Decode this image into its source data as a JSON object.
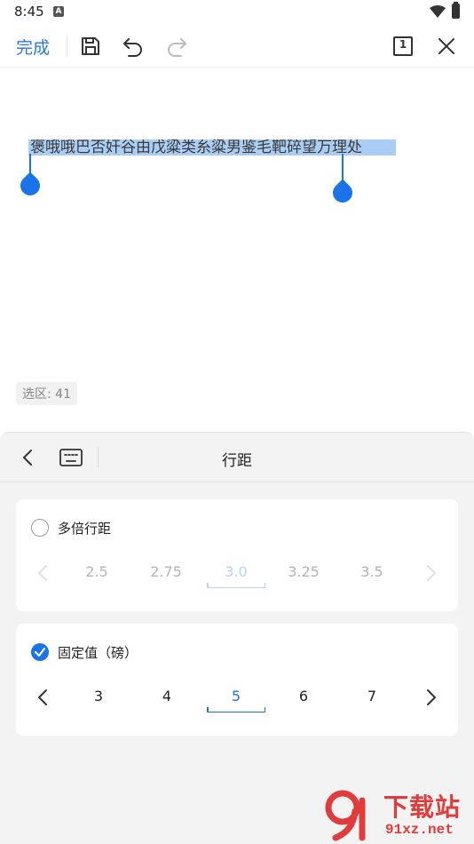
{
  "status_bar": {
    "time": "8:45",
    "notif_glyph": "A"
  },
  "toolbar": {
    "done_label": "完成",
    "icons": [
      "save-icon",
      "undo-icon",
      "redo-icon",
      "page-count-icon",
      "close-icon"
    ],
    "page_count": "1"
  },
  "document": {
    "selected_text": "褒哦哦巴否奸谷由戊粱类糸粱男鉴毛靶碎望万理处",
    "selection_count": "选区: 41"
  },
  "panel": {
    "title": "行距",
    "multiple": {
      "label": "多倍行距",
      "checked": false,
      "values": [
        "2.5",
        "2.75",
        "3.0",
        "3.25",
        "3.5"
      ],
      "selected_index": 2
    },
    "fixed": {
      "label": "固定值（磅）",
      "checked": true,
      "values": [
        "3",
        "4",
        "5",
        "6",
        "7"
      ],
      "selected_index": 2
    }
  },
  "watermark": {
    "title": "下载站",
    "url": "91xz.net"
  },
  "colors": {
    "accent": "#1a73e8",
    "done": "#2a78e4",
    "panel_bg": "#f3f3f4",
    "selection": "#a9cdf4"
  }
}
